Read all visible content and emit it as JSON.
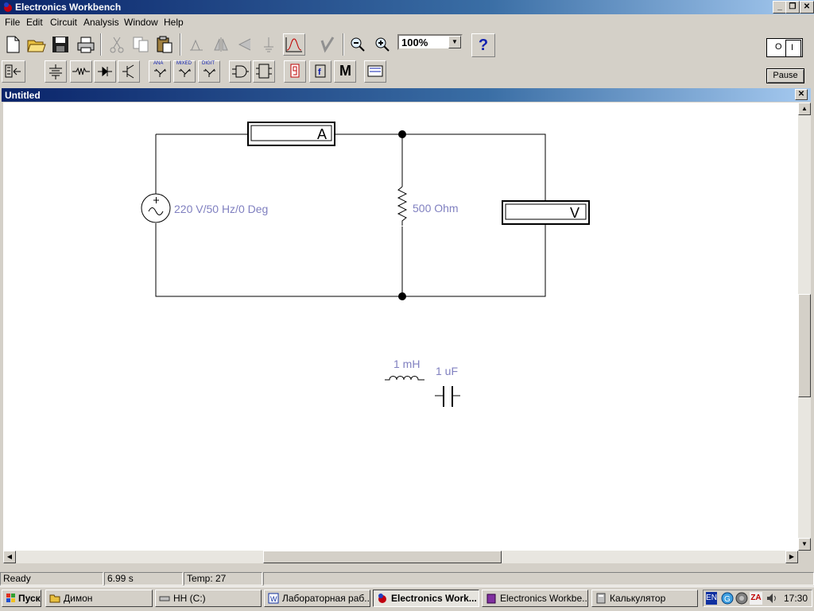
{
  "app": {
    "title": "Electronics Workbench"
  },
  "menu": [
    "File",
    "Edit",
    "Circuit",
    "Analysis",
    "Window",
    "Help"
  ],
  "toolbar": {
    "zoom_value": "100%",
    "help_label": "?",
    "part_bins": {
      "analog": "ANA",
      "mixed": "MIXED",
      "digital": "DIGIT",
      "misc": "M"
    }
  },
  "power": {
    "label_off": "O",
    "label_on": "I"
  },
  "pause_label": "Pause",
  "document": {
    "title": "Untitled"
  },
  "circuit": {
    "source_label": "220 V/50 Hz/0 Deg",
    "resistor_label": "500  Ohm",
    "ammeter_label": "A",
    "voltmeter_label": "V",
    "inductor_label": "1 mH",
    "capacitor_label": "1 uF"
  },
  "status": {
    "state": "Ready",
    "time": "6.99 s",
    "temp": "Temp:  27"
  },
  "taskbar": {
    "start_label": "Пуск",
    "tasks": [
      "Димон",
      "HH (C:)",
      "Лабораторная раб...",
      "Electronics Work...",
      "Electronics Workbe...",
      "Калькулятор"
    ],
    "lang": "EN",
    "clock": "17:30",
    "tray_za": "ZA"
  }
}
